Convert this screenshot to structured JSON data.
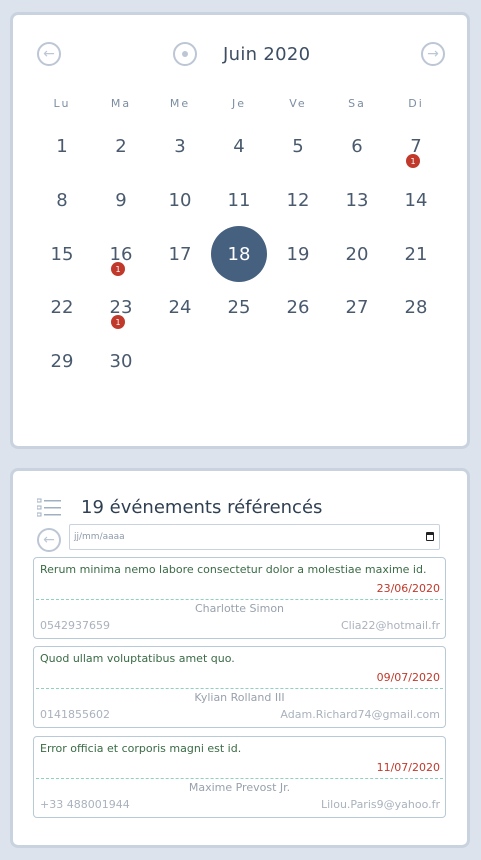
{
  "calendar": {
    "month_title": "Juin 2020",
    "prev_icon": "arrow-left-circle-icon",
    "today_icon": "dot-circle-icon",
    "next_icon": "arrow-right-circle-icon",
    "weekdays": [
      "Lu",
      "Ma",
      "Me",
      "Je",
      "Ve",
      "Sa",
      "Di"
    ],
    "days": [
      "1",
      "2",
      "3",
      "4",
      "5",
      "6",
      "7",
      "8",
      "9",
      "10",
      "11",
      "12",
      "13",
      "14",
      "15",
      "16",
      "17",
      "18",
      "19",
      "20",
      "21",
      "22",
      "23",
      "24",
      "25",
      "26",
      "27",
      "28",
      "29",
      "30"
    ],
    "today": "18",
    "event_counts": {
      "7": "1",
      "16": "1",
      "23": "1"
    },
    "colors": {
      "today_bg": "#46617f",
      "badge": "#c0392b"
    }
  },
  "events": {
    "title": "19 événements référencés",
    "list_icon": "list-icon",
    "back_icon": "arrow-left-circle-icon",
    "date_placeholder": "jj/mm/aaaa",
    "items": [
      {
        "title": "Rerum minima nemo labore consectetur dolor a molestiae maxime id.",
        "date": "23/06/2020",
        "name": "Charlotte Simon",
        "phone": "0542937659",
        "email": "Clia22@hotmail.fr"
      },
      {
        "title": "Quod ullam voluptatibus amet quo.",
        "date": "09/07/2020",
        "name": "Kylian Rolland III",
        "phone": "0141855602",
        "email": "Adam.Richard74@gmail.com"
      },
      {
        "title": "Error officia et corporis magni est id.",
        "date": "11/07/2020",
        "name": "Maxime Prevost Jr.",
        "phone": "+33 488001944",
        "email": "Lilou.Paris9@yahoo.fr"
      }
    ]
  }
}
